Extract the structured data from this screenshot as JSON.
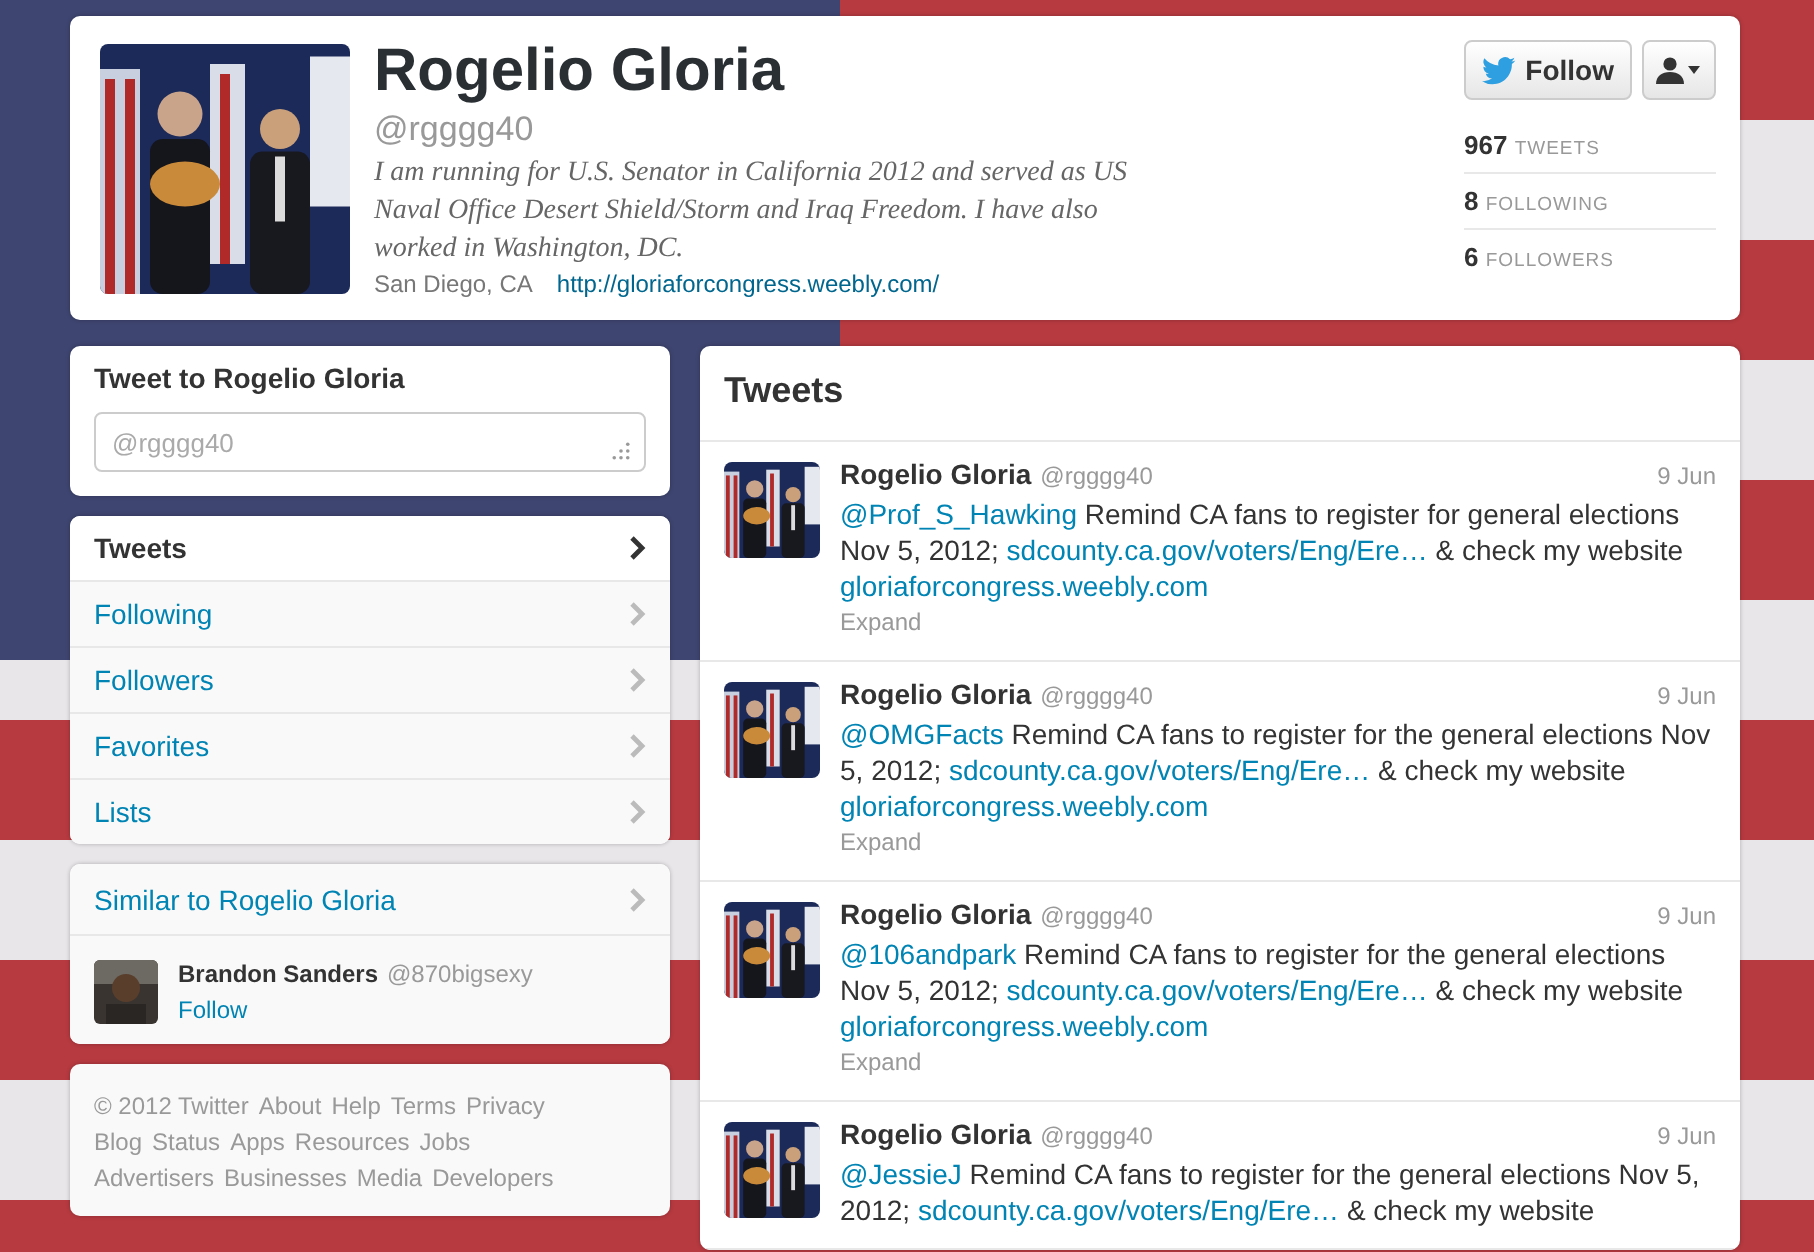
{
  "profile": {
    "name": "Rogelio Gloria",
    "handle": "@rgggg40",
    "bio": "I am running for U.S. Senator in California 2012 and served as US Naval Office Desert Shield/Storm and Iraq Freedom. I have also worked in Washington, DC.",
    "location": "San Diego, CA",
    "url": "http://gloriaforcongress.weebly.com/",
    "follow_button": "Follow",
    "stats": [
      {
        "count": "967",
        "label": "TWEETS"
      },
      {
        "count": "8",
        "label": "FOLLOWING"
      },
      {
        "count": "6",
        "label": "FOLLOWERS"
      }
    ]
  },
  "tweet_box": {
    "title": "Tweet to Rogelio Gloria",
    "placeholder": "@rgggg40"
  },
  "nav": [
    {
      "label": "Tweets",
      "selected": true
    },
    {
      "label": "Following",
      "selected": false
    },
    {
      "label": "Followers",
      "selected": false
    },
    {
      "label": "Favorites",
      "selected": false
    },
    {
      "label": "Lists",
      "selected": false
    }
  ],
  "similar": {
    "title": "Similar to Rogelio Gloria",
    "users": [
      {
        "name": "Brandon Sanders",
        "handle": "@870bigsexy",
        "action": "Follow"
      }
    ]
  },
  "footer": {
    "lines": [
      [
        "© 2012 Twitter",
        "About",
        "Help",
        "Terms",
        "Privacy"
      ],
      [
        "Blog",
        "Status",
        "Apps",
        "Resources",
        "Jobs"
      ],
      [
        "Advertisers",
        "Businesses",
        "Media",
        "Developers"
      ]
    ]
  },
  "timeline": {
    "title": "Tweets",
    "tweets": [
      {
        "name": "Rogelio Gloria",
        "handle": "@rgggg40",
        "date": "9 Jun",
        "expand": "Expand",
        "parts": [
          {
            "kind": "link",
            "text": "@Prof_S_Hawking"
          },
          {
            "kind": "text",
            "text": " Remind CA fans to register for general elections Nov 5, 2012; "
          },
          {
            "kind": "link",
            "text": "sdcounty.ca.gov/voters/Eng/Ere…"
          },
          {
            "kind": "text",
            "text": " & check my website "
          },
          {
            "kind": "link",
            "text": "gloriaforcongress.weebly.com"
          }
        ]
      },
      {
        "name": "Rogelio Gloria",
        "handle": "@rgggg40",
        "date": "9 Jun",
        "expand": "Expand",
        "parts": [
          {
            "kind": "link",
            "text": "@OMGFacts"
          },
          {
            "kind": "text",
            "text": " Remind CA fans to register for the general elections Nov 5, 2012; "
          },
          {
            "kind": "link",
            "text": "sdcounty.ca.gov/voters/Eng/Ere…"
          },
          {
            "kind": "text",
            "text": " & check my website "
          },
          {
            "kind": "link",
            "text": "gloriaforcongress.weebly.com"
          }
        ]
      },
      {
        "name": "Rogelio Gloria",
        "handle": "@rgggg40",
        "date": "9 Jun",
        "expand": "Expand",
        "parts": [
          {
            "kind": "link",
            "text": "@106andpark"
          },
          {
            "kind": "text",
            "text": " Remind CA fans to register for the general elections Nov 5, 2012; "
          },
          {
            "kind": "link",
            "text": "sdcounty.ca.gov/voters/Eng/Ere…"
          },
          {
            "kind": "text",
            "text": " & check my website "
          },
          {
            "kind": "link",
            "text": "gloriaforcongress.weebly.com"
          }
        ]
      },
      {
        "name": "Rogelio Gloria",
        "handle": "@rgggg40",
        "date": "9 Jun",
        "parts": [
          {
            "kind": "link",
            "text": "@JessieJ"
          },
          {
            "kind": "text",
            "text": " Remind CA fans to register for the general elections Nov 5, 2012; "
          },
          {
            "kind": "link",
            "text": "sdcounty.ca.gov/voters/Eng/Ere…"
          },
          {
            "kind": "text",
            "text": " & check my website"
          }
        ]
      }
    ]
  }
}
